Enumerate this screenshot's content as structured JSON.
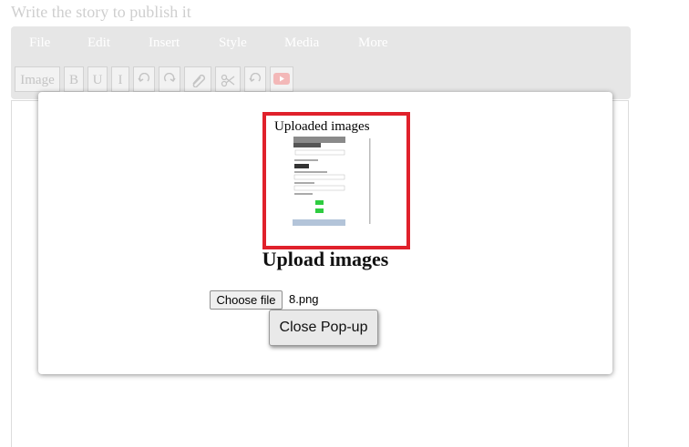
{
  "editor": {
    "title_placeholder": "Write the story to publish it",
    "menu": [
      "File",
      "Edit",
      "Insert",
      "Style",
      "Media",
      "More"
    ],
    "tools": {
      "image": "Image",
      "bold": "B",
      "underline": "U",
      "italic": "I"
    },
    "icons": [
      "undo-icon",
      "redo-icon",
      "attachment-icon",
      "cut-icon",
      "undo-icon",
      "youtube-icon"
    ]
  },
  "popup": {
    "uploaded_label": "Uploaded images",
    "heading": "Upload images",
    "choose_file_label": "Choose file",
    "file_name": "8.png",
    "close_label": "Close Pop-up"
  },
  "colors": {
    "toolbar_bg": "#e6e6e6",
    "highlight_border": "#e0212b",
    "thumb_accent": "#2ecc40"
  }
}
